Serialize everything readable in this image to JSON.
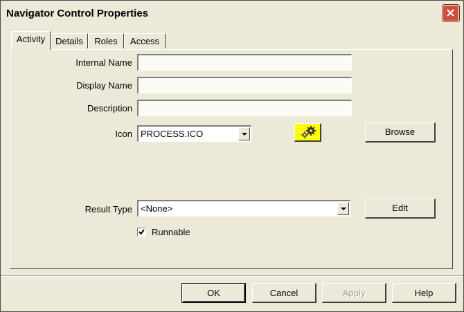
{
  "window": {
    "title": "Navigator Control Properties"
  },
  "tabs": [
    {
      "label": "Activity",
      "active": true
    },
    {
      "label": "Details",
      "active": false
    },
    {
      "label": "Roles",
      "active": false
    },
    {
      "label": "Access",
      "active": false
    }
  ],
  "form": {
    "internal_name": {
      "label": "Internal Name",
      "value": ""
    },
    "display_name": {
      "label": "Display Name",
      "value": ""
    },
    "description": {
      "label": "Description",
      "value": ""
    },
    "icon": {
      "label": "Icon",
      "value": "PROCESS.ICO",
      "preview_icon": "gears-icon"
    },
    "browse_label": "Browse",
    "result_type": {
      "label": "Result Type",
      "value": "<None>"
    },
    "edit_label": "Edit",
    "runnable": {
      "label": "Runnable",
      "checked": true
    }
  },
  "footer": {
    "ok_label": "OK",
    "cancel_label": "Cancel",
    "apply_label": "Apply",
    "help_label": "Help"
  },
  "colors": {
    "dialog_bg": "#ece9d8",
    "icon_button_bg": "#ffff00",
    "close_button": "#c8523a"
  }
}
